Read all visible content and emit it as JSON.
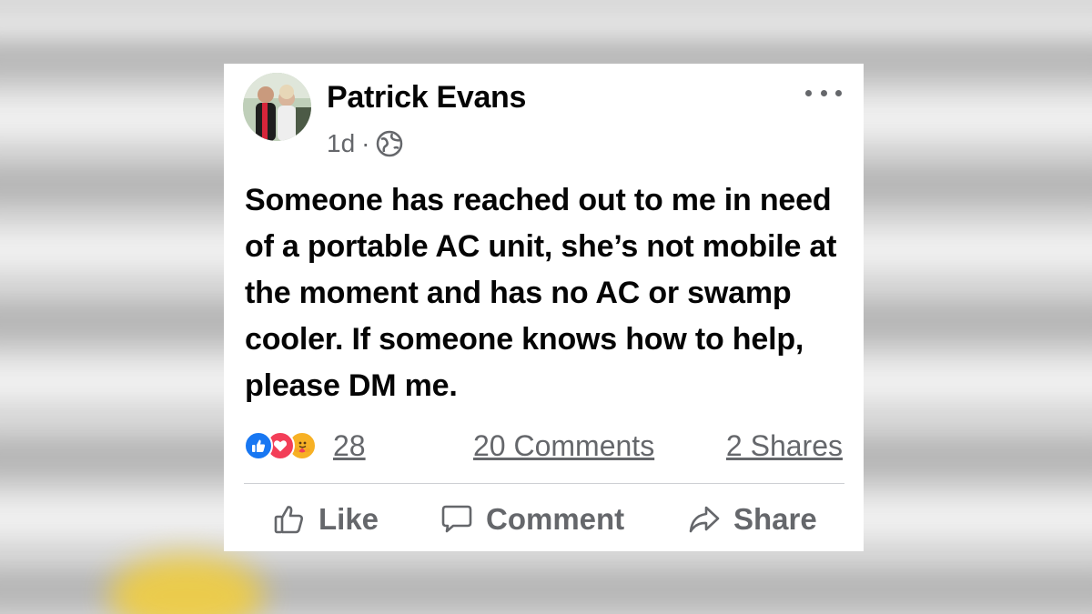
{
  "post": {
    "author": "Patrick Evans",
    "time": "1d",
    "separator": "·",
    "privacy_icon": "globe-icon",
    "more_icon": "more-options-icon",
    "text": "Someone has reached out to me in need of a portable AC unit, she’s not mobile at the moment and has no AC or swamp cooler. If someone knows how to help, please DM me.",
    "reactions": {
      "icons": [
        "like-reaction-icon",
        "love-reaction-icon",
        "care-reaction-icon"
      ],
      "count": "28"
    },
    "comments_label": "20 Comments",
    "shares_label": "2 Shares",
    "actions": {
      "like": "Like",
      "comment": "Comment",
      "share": "Share"
    }
  },
  "colors": {
    "text_primary": "#050505",
    "text_secondary": "#65676b",
    "like_blue": "#1877f2",
    "love_red": "#f33e58",
    "care_yellow": "#f7b125",
    "divider": "#ced0d4"
  }
}
